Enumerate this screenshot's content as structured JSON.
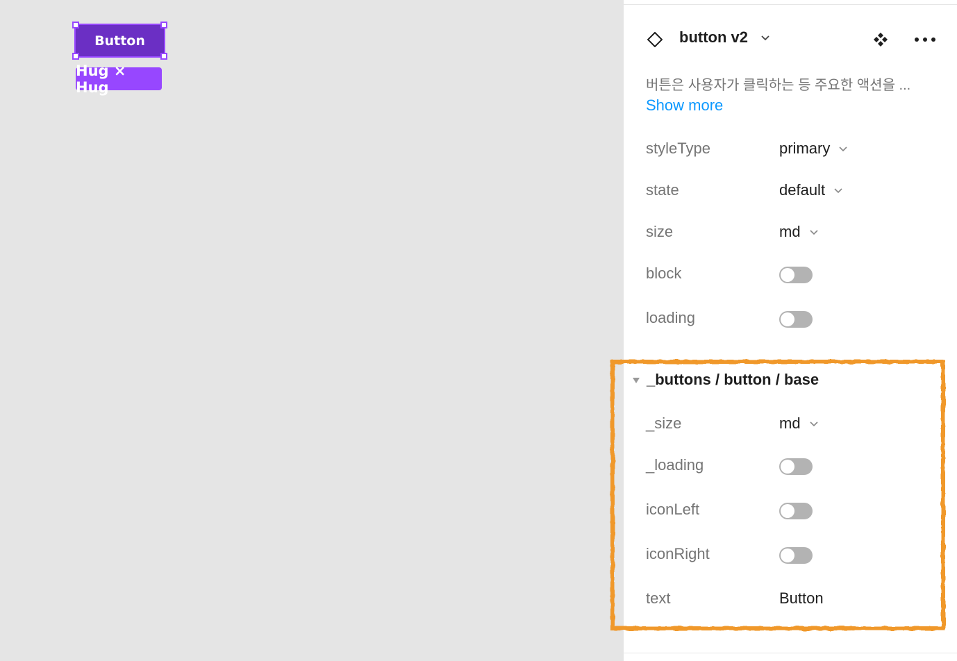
{
  "canvas": {
    "selected_button_label": "Button",
    "size_badge": "Hug × Hug"
  },
  "panel": {
    "component_name": "button v2",
    "description": "버튼은 사용자가 클릭하는 등 주요한 액션을 ...",
    "show_more": "Show more",
    "properties": [
      {
        "label": "styleType",
        "type": "dropdown",
        "value": "primary"
      },
      {
        "label": "state",
        "type": "dropdown",
        "value": "default"
      },
      {
        "label": "size",
        "type": "dropdown",
        "value": "md"
      },
      {
        "label": "block",
        "type": "toggle",
        "value": false
      },
      {
        "label": "loading",
        "type": "toggle",
        "value": false
      }
    ],
    "nested_section": {
      "title": "_buttons / button / base",
      "properties": [
        {
          "label": "_size",
          "type": "dropdown",
          "value": "md"
        },
        {
          "label": "_loading",
          "type": "toggle",
          "value": false
        },
        {
          "label": "iconLeft",
          "type": "toggle",
          "value": false
        },
        {
          "label": "iconRight",
          "type": "toggle",
          "value": false
        },
        {
          "label": "text",
          "type": "text",
          "value": "Button"
        }
      ]
    }
  },
  "colors": {
    "canvas_bg": "#e5e5e5",
    "selection": "#9747ff",
    "button_fill": "#6b2fc4",
    "link": "#0d99ff",
    "highlight": "#f0982b"
  }
}
